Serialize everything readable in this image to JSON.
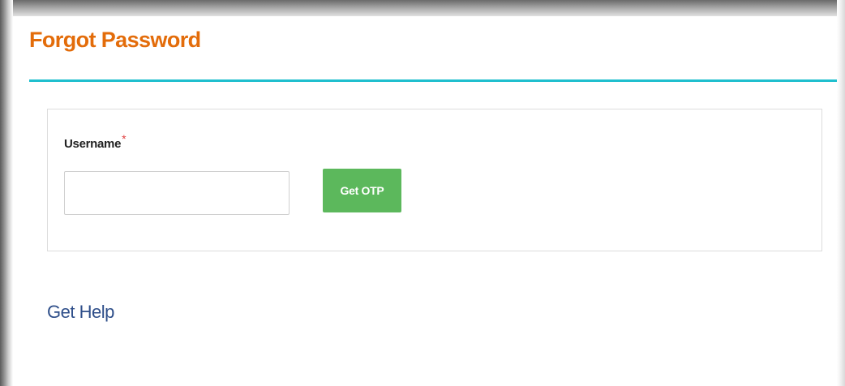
{
  "page": {
    "title": "Forgot Password"
  },
  "form": {
    "username_label": "Username",
    "required_marker": "*",
    "username_value": "",
    "username_placeholder": "",
    "submit_label": "Get OTP"
  },
  "footer": {
    "help_link": "Get Help"
  },
  "colors": {
    "title": "#e36c0a",
    "divider": "#1fbfce",
    "button": "#5cb85c",
    "required": "#e04040",
    "link": "#2f4f8a"
  }
}
